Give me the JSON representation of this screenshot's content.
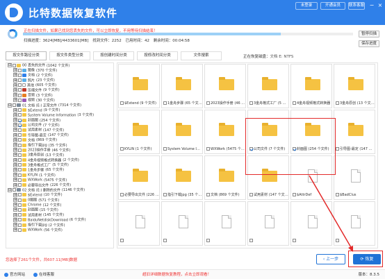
{
  "app": {
    "title": "比特数据恢复软件",
    "top_buttons": [
      "未登录",
      "开通会员",
      "联系客服"
    ]
  },
  "scan": {
    "status": "正在扫描文件，如果已找到您丢失的文件，可以立即恢复，不用等待扫描结束！",
    "progress": 0.78,
    "stats": [
      "扫描进度：3624[MB]/4433601[MB]",
      "找到文件：2252",
      "已用时间：42",
      "剩余时间：00:04:58"
    ],
    "pause": "暂停扫描",
    "save": "保存进度"
  },
  "tabs": [
    "按文件路径分类",
    "按文件类型分类",
    "按创建时间分类",
    "按修改时间分类",
    "文件搜索"
  ],
  "location": {
    "label": "正在恢复磁盘：",
    "value": "文档 E: NTFS"
  },
  "tree": [
    {
      "indent": 0,
      "exp": "⊟",
      "cb": false,
      "icon": "folder",
      "name": "00 丢失的文件",
      "count": "(1042 个文件)"
    },
    {
      "indent": 1,
      "exp": "⊞",
      "cb": false,
      "icon": "img",
      "name": "图像",
      "count": "(370 个文件)"
    },
    {
      "indent": 1,
      "exp": "⊞",
      "cb": false,
      "icon": "doc",
      "name": "文档",
      "count": "(2 个文件)"
    },
    {
      "indent": 1,
      "exp": "⊞",
      "cb": false,
      "icon": "img",
      "name": "照片",
      "count": "(23 个文件)"
    },
    {
      "indent": 1,
      "exp": "⊞",
      "cb": false,
      "icon": "file",
      "name": "其他",
      "count": "(605 个文件)"
    },
    {
      "indent": 1,
      "exp": "⊞",
      "cb": false,
      "icon": "zip",
      "name": "压缩文件",
      "count": "(9 个文件)"
    },
    {
      "indent": 1,
      "exp": "⊞",
      "cb": false,
      "icon": "mus",
      "name": "音频",
      "count": "(3 个文件)"
    },
    {
      "indent": 1,
      "exp": "⊞",
      "cb": false,
      "icon": "vid",
      "name": "视频",
      "count": "(30 个文件)"
    },
    {
      "indent": 0,
      "exp": "⊟",
      "cb": false,
      "icon": "drive",
      "name": "01 文档 (E:) 正常文件",
      "count": "(7314 个文件)"
    },
    {
      "indent": 1,
      "exp": "⊞",
      "cb": false,
      "icon": "folder",
      "name": "$Extend",
      "count": "(9 个文件)"
    },
    {
      "indent": 1,
      "exp": "⊞",
      "cb": false,
      "icon": "folder",
      "name": "System Volume Information",
      "count": "(3 个文件)"
    },
    {
      "indent": 1,
      "exp": "⊞",
      "cb": true,
      "icon": "folder",
      "name": "封面图",
      "count": "(254 个文件)"
    },
    {
      "indent": 1,
      "exp": "⊞",
      "cb": true,
      "icon": "folder",
      "name": "公司文件",
      "count": "(7 个文件)"
    },
    {
      "indent": 1,
      "exp": "⊞",
      "cb": false,
      "icon": "folder",
      "name": "试用素材",
      "count": "(147 个文件)"
    },
    {
      "indent": 1,
      "exp": "⊞",
      "cb": false,
      "icon": "folder",
      "name": "引导图-最定",
      "count": "(147 个文件)"
    },
    {
      "indent": 1,
      "exp": "⊞",
      "cb": false,
      "icon": "folder",
      "name": "文档",
      "count": "(869 个文件)"
    },
    {
      "indent": 1,
      "exp": "⊞",
      "cb": false,
      "icon": "folder",
      "name": "指引下载jpg",
      "count": "(35 个文件)"
    },
    {
      "indent": 1,
      "exp": "⊞",
      "cb": false,
      "icon": "folder",
      "name": "2023操作手册",
      "count": "(46 个文件)"
    },
    {
      "indent": 1,
      "exp": "⊞",
      "cb": false,
      "icon": "folder",
      "name": "3金舟原创",
      "count": "(13 个文件)"
    },
    {
      "indent": 1,
      "exp": "⊞",
      "cb": false,
      "icon": "folder",
      "name": "4金舟视频格式转换器",
      "count": "(2 个文件)"
    },
    {
      "indent": 1,
      "exp": "⊞",
      "cb": false,
      "icon": "folder",
      "name": "3金舟格式工厂",
      "count": "(5 个文件)"
    },
    {
      "indent": 1,
      "exp": "⊞",
      "cb": false,
      "icon": "folder",
      "name": "1金舟步骤",
      "count": "(65 个文件)"
    },
    {
      "indent": 1,
      "exp": "⊞",
      "cb": false,
      "icon": "folder",
      "name": "KYLIN",
      "count": "(1 个文件)"
    },
    {
      "indent": 1,
      "exp": "⊞",
      "cb": false,
      "icon": "folder",
      "name": "WXWork",
      "count": "(5475 个文件)"
    },
    {
      "indent": 1,
      "exp": "⊞",
      "cb": false,
      "icon": "folder",
      "name": "必要导出文件",
      "count": "(226 个文件)"
    },
    {
      "indent": 0,
      "exp": "⊟",
      "cb": false,
      "icon": "drive",
      "name": "02 文档 (E:) 删除的文件",
      "count": "(1146 个文件)"
    },
    {
      "indent": 1,
      "exp": "⊞",
      "cb": false,
      "icon": "folder",
      "name": "$Extend",
      "count": "(10 个文件)"
    },
    {
      "indent": 1,
      "exp": "⊞",
      "cb": false,
      "icon": "folder",
      "name": "0图图",
      "count": "(571 个文件)"
    },
    {
      "indent": 1,
      "exp": "⊞",
      "cb": false,
      "icon": "folder",
      "name": "Chrome",
      "count": "(12 个文件)"
    },
    {
      "indent": 1,
      "exp": "⊞",
      "cb": false,
      "icon": "folder",
      "name": "封面图",
      "count": "(15 个文件)"
    },
    {
      "indent": 1,
      "exp": "⊞",
      "cb": false,
      "icon": "folder",
      "name": "试用素材",
      "count": "(145 个文件)"
    },
    {
      "indent": 1,
      "exp": "⊞",
      "cb": false,
      "icon": "folder",
      "name": "BaiduNetdiskDownload",
      "count": "(6 个文件)"
    },
    {
      "indent": 1,
      "exp": "⊞",
      "cb": false,
      "icon": "folder",
      "name": "指引下载jpg",
      "count": "(2 个文件)"
    },
    {
      "indent": 1,
      "exp": "⊞",
      "cb": false,
      "icon": "folder",
      "name": "WXWork",
      "count": "(56 个文件)"
    }
  ],
  "grid": [
    {
      "label": "$Extend (9 个文件)",
      "checked": false,
      "type": "folder"
    },
    {
      "label": "1金舟步骤 (65 个文件)",
      "checked": false,
      "type": "folder"
    },
    {
      "label": "2023操作手册 (46 个文件)",
      "checked": false,
      "type": "folder"
    },
    {
      "label": "3金舟格式工厂 (5 个文件)",
      "checked": false,
      "type": "folder"
    },
    {
      "label": "4金舟视频格式转换器",
      "checked": false,
      "type": "folder"
    },
    {
      "label": "3金舟原创 (13 个文件)",
      "checked": false,
      "type": "folder"
    },
    {
      "label": "KYLIN (1 个文件)",
      "checked": false,
      "type": "folder"
    },
    {
      "label": "System Volume Information",
      "checked": false,
      "type": "folder"
    },
    {
      "label": "WXWork (5475 个文件)",
      "checked": false,
      "type": "folder"
    },
    {
      "label": "公司文件 (7 个文件)",
      "checked": true,
      "type": "folder"
    },
    {
      "label": "封面图 (254 个文件)",
      "checked": true,
      "type": "folder"
    },
    {
      "label": "引导图-最定 (147 个文件)",
      "checked": false,
      "type": "folder"
    },
    {
      "label": "必要导出文件 (226 个文件)",
      "checked": false,
      "type": "folder"
    },
    {
      "label": "指引下载jpg (35 个文件)",
      "checked": false,
      "type": "folder"
    },
    {
      "label": "文档 (869 个文件)",
      "checked": false,
      "type": "folder"
    },
    {
      "label": "试用素材 (147 个文件)",
      "checked": false,
      "type": "folder"
    },
    {
      "label": "$AttrDef",
      "checked": false,
      "type": "doc"
    },
    {
      "label": "$BadClus",
      "checked": false,
      "type": "doc"
    },
    {
      "label": "",
      "checked": false,
      "type": "doc"
    },
    {
      "label": "",
      "checked": false,
      "type": "doc"
    },
    {
      "label": "",
      "checked": false,
      "type": "doc"
    },
    {
      "label": "",
      "checked": false,
      "type": "doc"
    },
    {
      "label": "",
      "checked": false,
      "type": "doc"
    },
    {
      "label": "",
      "checked": false,
      "type": "doc"
    }
  ],
  "footer": {
    "selected": "您选择了261个文件，共607.11[MB]数据",
    "prev": "上一步",
    "recover": "恢复",
    "website": "官方网站",
    "support": "在线客服",
    "note": "超旧详细数据恢复教程，点击立即观看！",
    "version": "版本：8.3.5"
  },
  "colors": {
    "brand": "#2f80e9",
    "highlight": "#e32a2a",
    "warn": "#e33333"
  }
}
